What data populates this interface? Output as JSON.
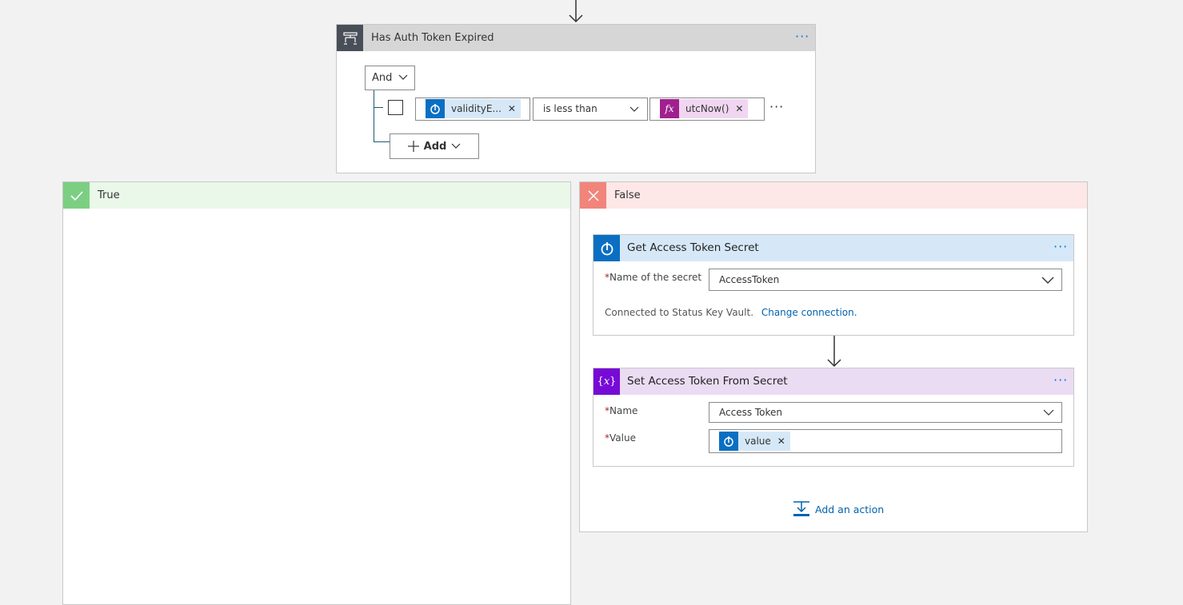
{
  "condition": {
    "title": "Has Auth Token Expired",
    "operator_group": "And",
    "row": {
      "left_token": "validityE...",
      "comparator": "is less than",
      "right_token": "utcNow()"
    },
    "add_label": "Add",
    "more_symbol": "···"
  },
  "true_branch": {
    "label": "True"
  },
  "false_branch": {
    "label": "False",
    "actions": [
      {
        "title": "Get Access Token Secret",
        "field_label": "Name of the secret",
        "field_value": "AccessToken",
        "connection_text": "Connected to Status Key Vault.",
        "change_connection": "Change connection."
      },
      {
        "title": "Set Access Token From Secret",
        "name_label": "Name",
        "name_value": "Access Token",
        "value_label": "Value",
        "value_token": "value"
      }
    ],
    "add_action_label": "Add an action"
  },
  "icons": {
    "condition": "condition-icon",
    "key_vault": "key-vault-icon",
    "expression": "fx-icon",
    "variable": "variable-icon",
    "check": "check-icon",
    "close": "close-icon",
    "add": "plus-icon",
    "chevron": "chevron-down-icon",
    "arrow": "arrow-down-icon"
  },
  "colors": {
    "canvas": "#f2f2f2",
    "condition_header": "#d6d6d6",
    "condition_icon": "#484f58",
    "true_header": "#eaf8ea",
    "true_icon": "#7ccf82",
    "false_header": "#fde7e7",
    "false_icon": "#f1857b",
    "keyvault_header": "#d6e8f7",
    "keyvault_icon": "#0a6fc2",
    "variable_header": "#eadcf3",
    "variable_icon": "#770bd6",
    "fx_token": "#f0d6f0",
    "fx_icon": "#a1208f",
    "link": "#0062ad"
  }
}
